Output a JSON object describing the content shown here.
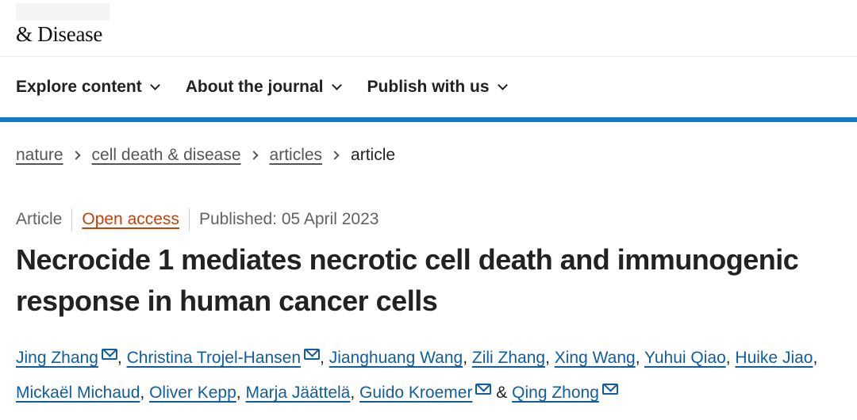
{
  "brand": {
    "logo_text": "& Disease"
  },
  "nav": {
    "items": [
      {
        "label": "Explore content"
      },
      {
        "label": "About the journal"
      },
      {
        "label": "Publish with us"
      }
    ]
  },
  "breadcrumb": {
    "items": [
      "nature",
      "cell death & disease",
      "articles"
    ],
    "current": "article"
  },
  "article": {
    "type": "Article",
    "access": "Open access",
    "published": "Published: 05 April 2023",
    "title": "Necrocide 1 mediates necrotic cell death and immunogenic response in human cancer cells"
  },
  "authors": {
    "list": [
      {
        "name": "Jing Zhang",
        "email": true
      },
      {
        "name": "Christina Trojel-Hansen",
        "email": true
      },
      {
        "name": "Jianghuang Wang",
        "email": false
      },
      {
        "name": "Zili Zhang",
        "email": false
      },
      {
        "name": "Xing Wang",
        "email": false
      },
      {
        "name": "Yuhui Qiao",
        "email": false
      },
      {
        "name": "Huike Jiao",
        "email": false
      },
      {
        "name": "Mickaël Michaud",
        "email": false
      },
      {
        "name": "Oliver Kepp",
        "email": false
      },
      {
        "name": "Marja Jäättelä",
        "email": false
      },
      {
        "name": "Guido Kroemer",
        "email": true
      },
      {
        "name": "Qing Zhong",
        "email": true
      }
    ],
    "separator": ", ",
    "last_joiner": " & "
  },
  "colors": {
    "nav_rule": "#0f7bc6",
    "author_link": "#0f5ea3",
    "open_access": "#c4410c"
  }
}
